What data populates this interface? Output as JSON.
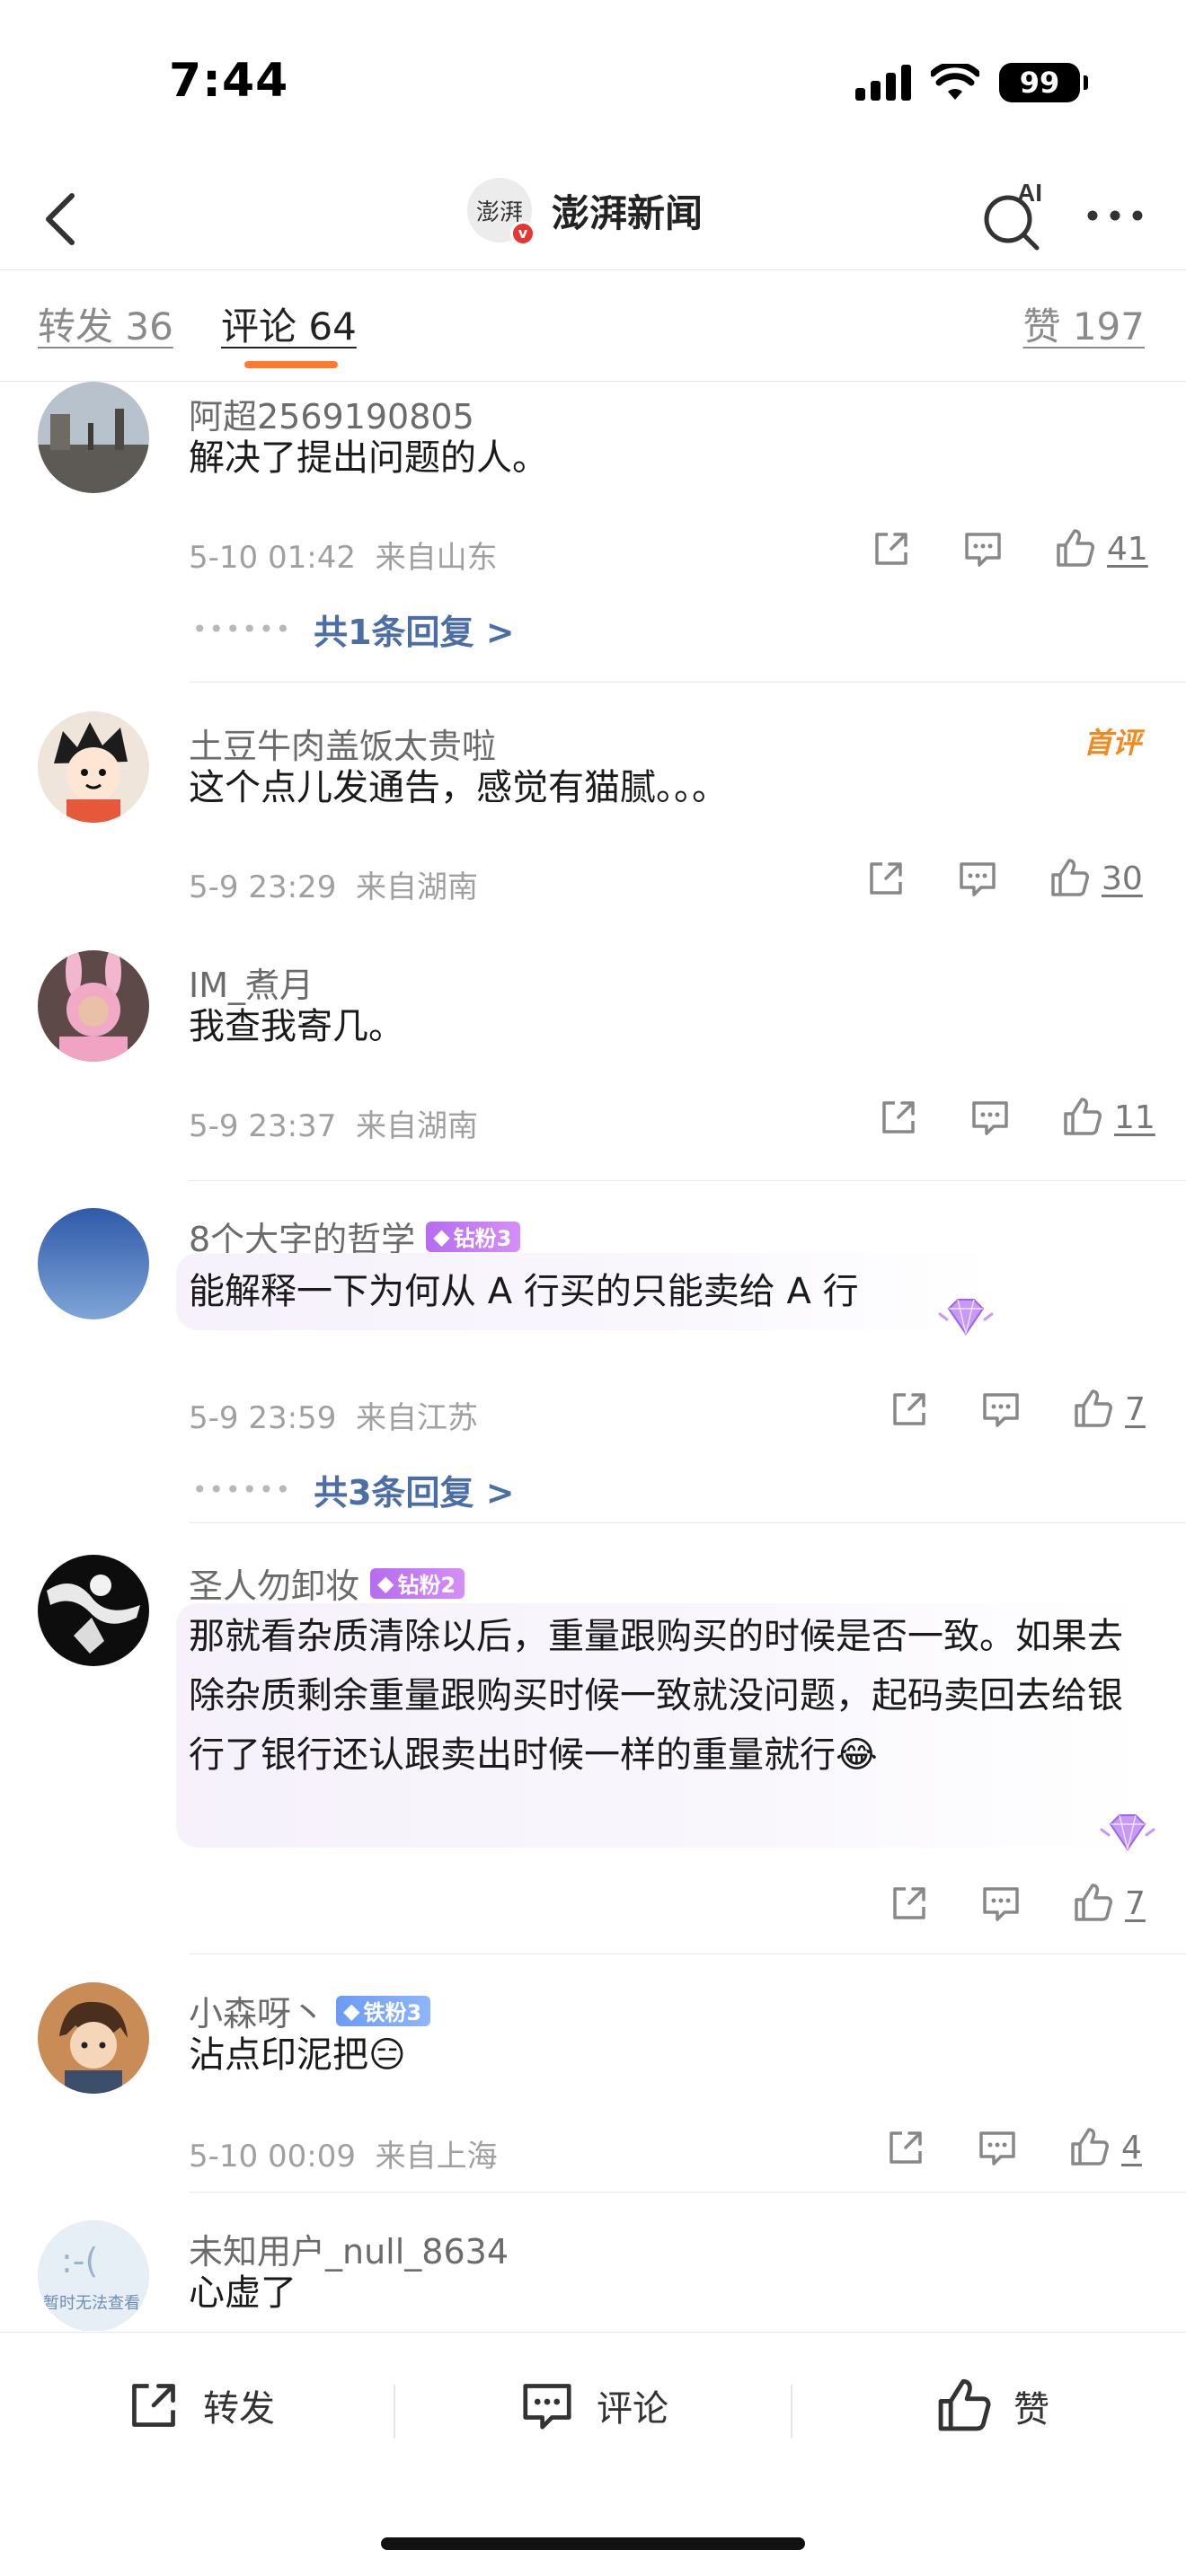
{
  "status_bar": {
    "time": "7:44",
    "battery": "99"
  },
  "nav": {
    "title": "澎湃新闻",
    "logo_text": "澎湃",
    "verified_mark": "v",
    "ai_label": "AI"
  },
  "tabs": {
    "repost": "转发 36",
    "comments": "评论 64",
    "likes": "赞 197"
  },
  "comments": [
    {
      "name": "阿超2569190805",
      "text": "解决了提出问题的人。",
      "time": "5-10 01:42",
      "location": "来自山东",
      "likes": "41",
      "replies": "共1条回复 >"
    },
    {
      "name": "土豆牛肉盖饭太贵啦",
      "first_badge": "首评",
      "text": "这个点儿发通告，感觉有猫腻。。。",
      "time": "5-9 23:29",
      "location": "来自湖南",
      "likes": "30"
    },
    {
      "name": "IM_煮月",
      "text": "我查我寄几。",
      "time": "5-9 23:37",
      "location": "来自湖南",
      "likes": "11"
    },
    {
      "name": "8个大字的哲学",
      "fan_badge": "钻粉3",
      "text": "能解释一下为何从 A 行买的只能卖给 A 行",
      "time": "5-9 23:59",
      "location": "来自江苏",
      "likes": "7",
      "replies": "共3条回复 >"
    },
    {
      "name": "圣人勿卸妆",
      "fan_badge": "钻粉2",
      "text": "那就看杂质清除以后，重量跟购买的时候是否一致。如果去除杂质剩余重量跟购买时候一致就没问题，起码卖回去给银行了银行还认跟卖出时候一样的重量就行😂",
      "likes": "7"
    },
    {
      "name": "小森呀丶",
      "fan_badge": "铁粉3",
      "text": "沾点印泥把😑",
      "time": "5-10 00:09",
      "location": "来自上海",
      "likes": "4"
    },
    {
      "name": "未知用户_null_8634",
      "text": "心虚了",
      "avatar_text": "暂时无法查看"
    }
  ],
  "bottom_bar": {
    "repost": "转发",
    "comment": "评论",
    "like": "赞"
  },
  "colors": {
    "accent": "#ff7a2c",
    "link": "#4b6ea6",
    "badge_purple": "#c27bf3",
    "badge_blue": "#7aa6f8",
    "first_comment": "#f08a1e"
  },
  "icons": [
    "back-icon",
    "ai-search-icon",
    "more-icon",
    "share-icon",
    "comment-icon",
    "like-icon",
    "gem-icon"
  ]
}
